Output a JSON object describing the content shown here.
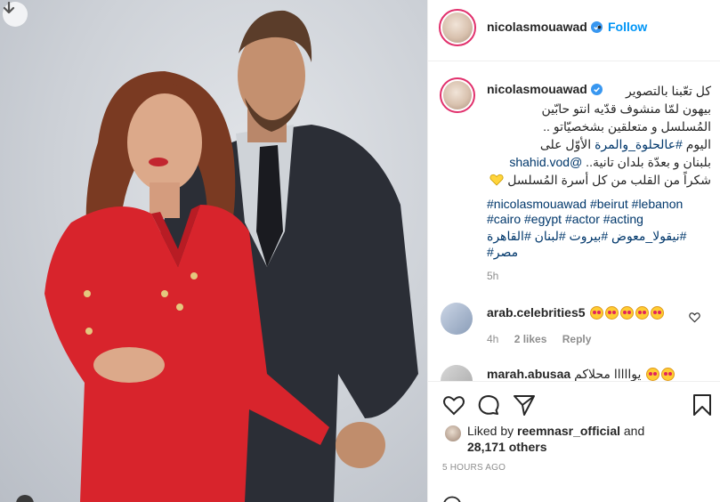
{
  "post": {
    "username": "nicolasmouawad",
    "dot": "•",
    "follow_label": "Follow",
    "caption_lines": [
      "كل تعّبنا بالتصوير",
      "بيهون لمّا منشوف قدّيه انتو حابّين",
      "المُسلسل و متعلقين بشخصيّاتو ..",
      "اليوم ",
      "بلبنان و بعدّة بلدان تانية.. ",
      "شكراً من القلب من كل أسرة المُسلسل"
    ],
    "caption_inline_tags": [
      "#عالحلوة_والمرة",
      " الأوّل على"
    ],
    "caption_mention": "@shahid.vod",
    "caption_tags_row1": "#nicolasmouawad #beirut #lebanon",
    "caption_tags_row2": "#cairo #egypt #actor #acting",
    "caption_tags_row3": "#نيقولا_معوض #بيروت #لبنان #القاهرة",
    "caption_tags_row4": "#مصر",
    "age": "5h"
  },
  "comments": [
    {
      "user": "arab.celebrities5",
      "emoji_count": 5,
      "age": "4h",
      "likes": "2 likes",
      "reply": "Reply"
    },
    {
      "user": "marah.abusaa",
      "text": "يوااااا محلاكم",
      "emoji_count": 2
    }
  ],
  "likes": {
    "prefix": "Liked by",
    "user": "reemnasr_official",
    "connector": "and",
    "others": "28,171 others"
  },
  "timestamp": "5 HOURS AGO",
  "colors": {
    "accent": "#0095f6",
    "hashtag": "#00376b",
    "muted": "#8e8e8e",
    "story_ring": "#e1306c"
  },
  "icons": [
    "download-icon",
    "verified-icon",
    "heart-icon",
    "comment-icon",
    "share-icon",
    "bookmark-icon",
    "emoji-icon"
  ]
}
